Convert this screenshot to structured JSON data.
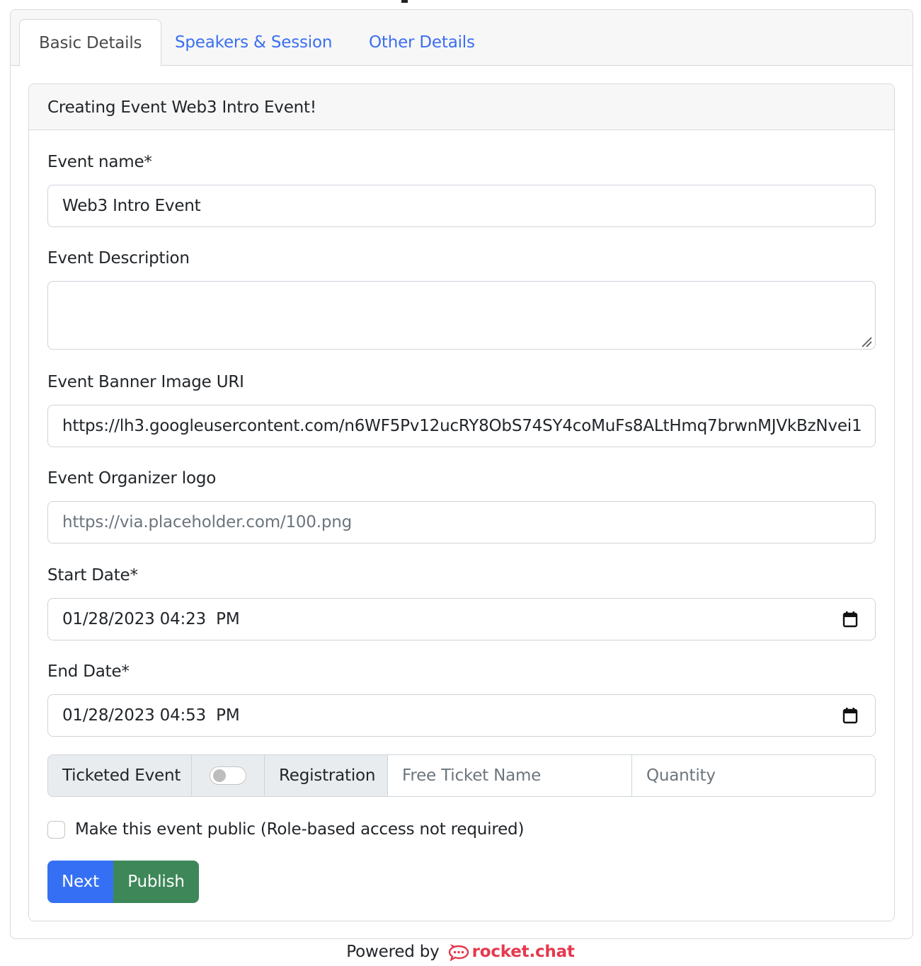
{
  "tabs": [
    {
      "label": "Basic Details",
      "active": true
    },
    {
      "label": "Speakers & Session",
      "active": false
    },
    {
      "label": "Other Details",
      "active": false
    }
  ],
  "card": {
    "header": "Creating Event Web3 Intro Event!"
  },
  "form": {
    "event_name": {
      "label": "Event name*",
      "value": "Web3 Intro Event"
    },
    "event_description": {
      "label": "Event Description",
      "value": ""
    },
    "banner_image": {
      "label": "Event Banner Image URI",
      "value": "https://lh3.googleusercontent.com/n6WF5Pv12ucRY8ObS74SY4coMuFs8ALtHmq7brwnMJVkBzNvei1"
    },
    "organizer_logo": {
      "label": "Event Organizer logo",
      "placeholder": "https://via.placeholder.com/100.png"
    },
    "start_date": {
      "label": "Start Date*",
      "value": "01/28/2023 04:23  PM"
    },
    "end_date": {
      "label": "End Date*",
      "value": "01/28/2023 04:53  PM"
    },
    "ticketing": {
      "ticketed_label": "Ticketed Event",
      "ticketed_on": false,
      "registration_label": "Registration",
      "ticket_name_placeholder": "Free Ticket Name",
      "quantity_placeholder": "Quantity"
    },
    "public_checkbox": {
      "label": "Make this event public (Role-based access not required)",
      "checked": false
    }
  },
  "buttons": {
    "next": "Next",
    "publish": "Publish"
  },
  "footer": {
    "powered_by": "Powered by",
    "brand": "rocket.chat"
  },
  "colors": {
    "primary": "#3570f4",
    "success": "#3e8759",
    "brand": "#e5384d",
    "tab_link": "#3a6ff0"
  }
}
